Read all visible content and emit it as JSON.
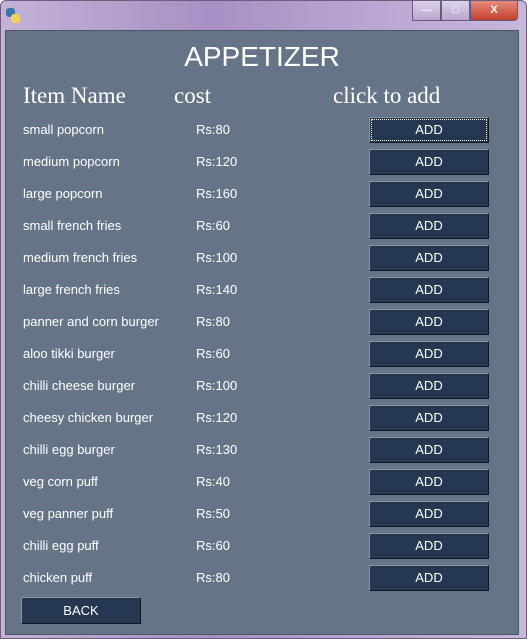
{
  "window": {
    "controls": {
      "minimize": "—",
      "maximize": "□",
      "close": "X"
    }
  },
  "title": "APPETIZER",
  "headers": {
    "item_name": "Item Name",
    "cost": "cost",
    "action": "click to add"
  },
  "items": [
    {
      "name": "small popcorn",
      "cost": "Rs:80",
      "button": "ADD"
    },
    {
      "name": "medium popcorn",
      "cost": "Rs:120",
      "button": "ADD"
    },
    {
      "name": "large popcorn",
      "cost": "Rs:160",
      "button": "ADD"
    },
    {
      "name": "small french fries",
      "cost": "Rs:60",
      "button": "ADD"
    },
    {
      "name": "medium french fries",
      "cost": "Rs:100",
      "button": "ADD"
    },
    {
      "name": "large french fries",
      "cost": "Rs:140",
      "button": "ADD"
    },
    {
      "name": "panner and corn burger",
      "cost": "Rs:80",
      "button": "ADD"
    },
    {
      "name": "aloo tikki burger",
      "cost": "Rs:60",
      "button": "ADD"
    },
    {
      "name": "chilli cheese burger",
      "cost": "Rs:100",
      "button": "ADD"
    },
    {
      "name": "cheesy chicken burger",
      "cost": "Rs:120",
      "button": "ADD"
    },
    {
      "name": "chilli egg burger",
      "cost": "Rs:130",
      "button": "ADD"
    },
    {
      "name": "veg corn puff",
      "cost": "Rs:40",
      "button": "ADD"
    },
    {
      "name": "veg panner puff",
      "cost": "Rs:50",
      "button": "ADD"
    },
    {
      "name": "chilli egg puff",
      "cost": "Rs:60",
      "button": "ADD"
    },
    {
      "name": "chicken puff",
      "cost": "Rs:80",
      "button": "ADD"
    }
  ],
  "back_label": "BACK",
  "colors": {
    "background": "#657587",
    "button": "#263752",
    "text": "#ffffff"
  }
}
